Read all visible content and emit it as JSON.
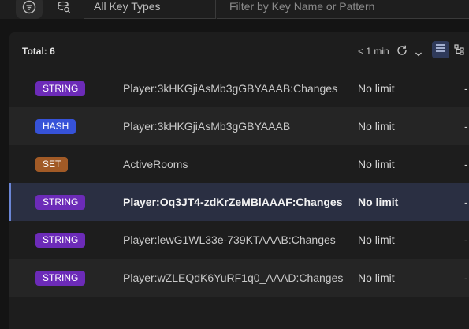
{
  "filter": {
    "type_placeholder": "All Key Types",
    "search_placeholder": "Filter by Key Name or Pattern"
  },
  "list": {
    "total_label": "Total: 6",
    "refresh_time": "< 1 min"
  },
  "colors": {
    "STRING": "#6c2bb8",
    "HASH": "#3652d8",
    "SET": "#a15a26"
  },
  "rows": [
    {
      "type": "STRING",
      "name": "Player:3kHKGjiAsMb3gGBYAAAB:Changes",
      "ttl": "No limit",
      "size": "-"
    },
    {
      "type": "HASH",
      "name": "Player:3kHKGjiAsMb3gGBYAAAB",
      "ttl": "No limit",
      "size": "-"
    },
    {
      "type": "SET",
      "name": "ActiveRooms",
      "ttl": "No limit",
      "size": "-"
    },
    {
      "type": "STRING",
      "name": "Player:Oq3JT4-zdKrZeMBlAAAF:Changes",
      "ttl": "No limit",
      "size": "-"
    },
    {
      "type": "STRING",
      "name": "Player:lewG1WL33e-739KTAAAB:Changes",
      "ttl": "No limit",
      "size": "-"
    },
    {
      "type": "STRING",
      "name": "Player:wZLEQdK6YuRF1q0_AAAD:Changes",
      "ttl": "No limit",
      "size": "-"
    }
  ]
}
